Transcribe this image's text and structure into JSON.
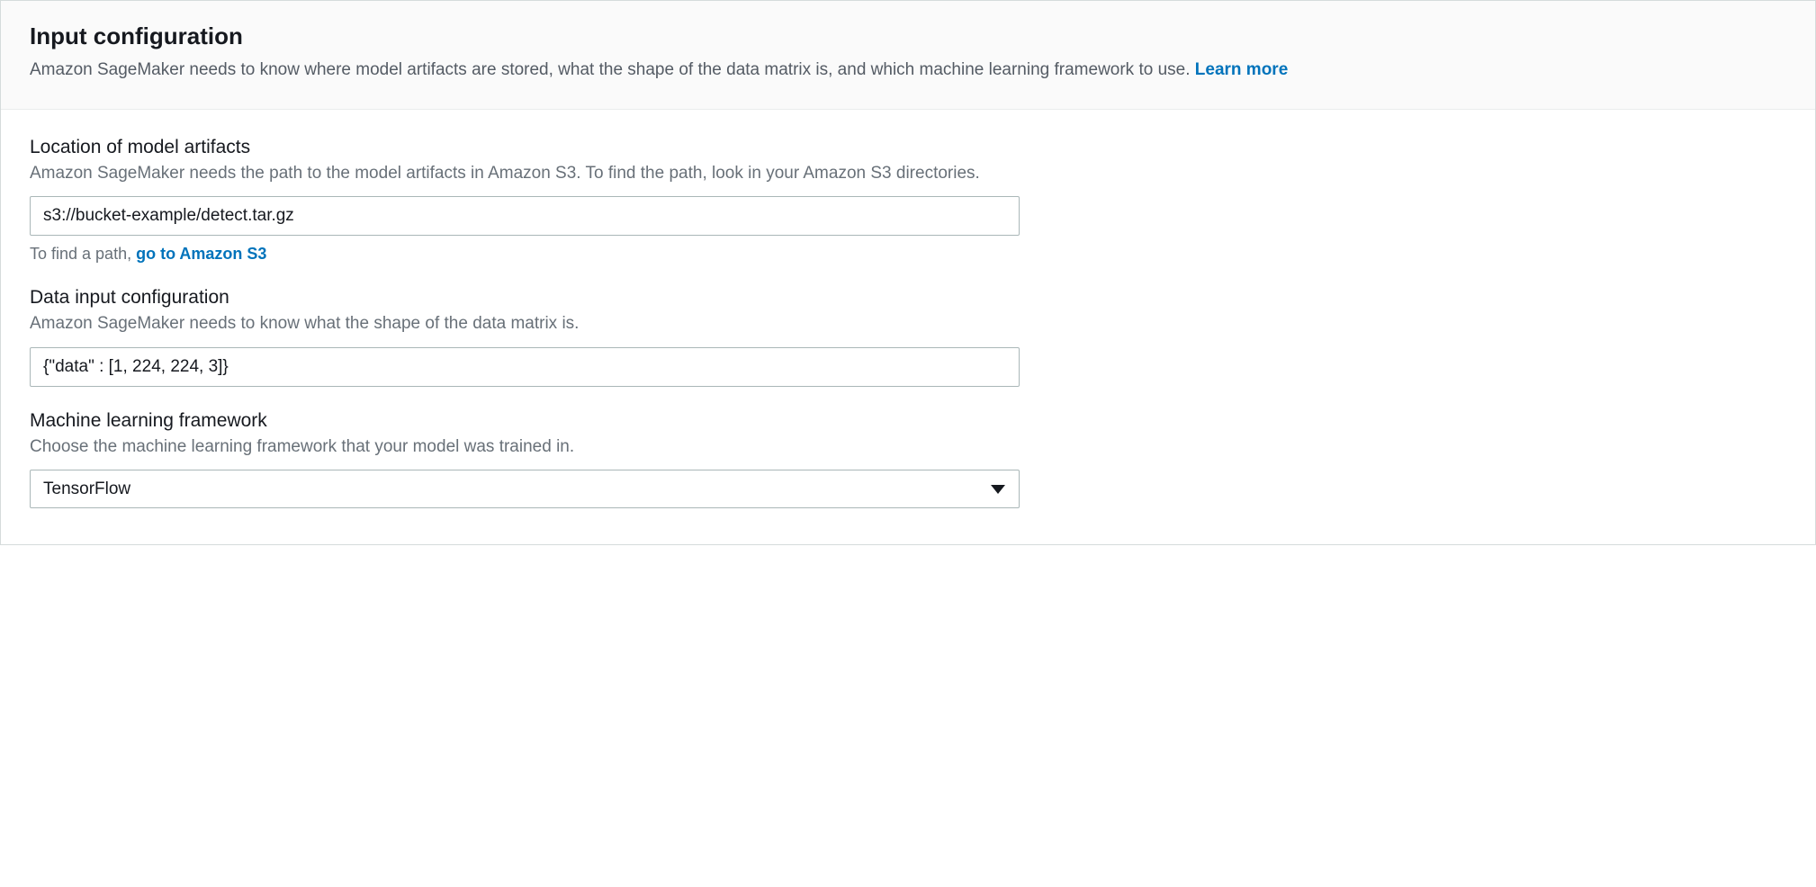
{
  "header": {
    "title": "Input configuration",
    "subtitle_prefix": "Amazon SageMaker needs to know where model artifacts are stored, what the shape of the data matrix is, and which machine learning framework to use.  ",
    "learn_more": "Learn more"
  },
  "fields": {
    "artifacts": {
      "label": "Location of model artifacts",
      "hint": "Amazon SageMaker needs the path to the model artifacts in Amazon S3. To find the path, look in your Amazon S3 directories.",
      "value": "s3://bucket-example/detect.tar.gz",
      "helper_prefix": "To find a path, ",
      "helper_link": "go to Amazon S3"
    },
    "data_input": {
      "label": "Data input configuration",
      "hint": "Amazon SageMaker needs to know what the shape of the data matrix is.",
      "value": "{\"data\" : [1, 224, 224, 3]}"
    },
    "framework": {
      "label": "Machine learning framework",
      "hint": "Choose the machine learning framework that your model was trained in.",
      "value": "TensorFlow"
    }
  }
}
